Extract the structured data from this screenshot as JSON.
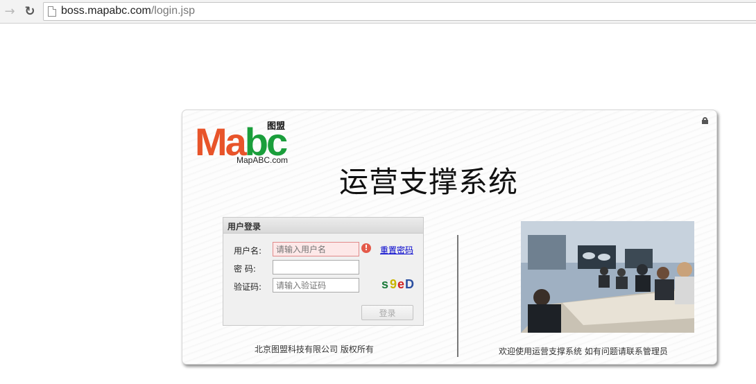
{
  "browser": {
    "url_domain": "boss.mapabc.com",
    "url_path": "/login.jsp",
    "forward_icon": "arrow-right-icon",
    "reload_icon": "reload-icon"
  },
  "logo": {
    "word_part1": "Ma",
    "word_part2": "bc",
    "cn_name": "图盟",
    "domain": "MapABC.com"
  },
  "page": {
    "title": "运营支撑系统",
    "copyright": "北京图盟科技有限公司 版权所有",
    "welcome": "欢迎使用运营支撑系统 如有问题请联系管理员"
  },
  "login": {
    "header": "用户登录",
    "username_label": "用户名:",
    "username_placeholder": "请输入用户名",
    "password_label": "密  码:",
    "captcha_label": "验证码:",
    "captcha_placeholder": "请输入验证码",
    "captcha_text": [
      "s",
      "9",
      "e",
      "D"
    ],
    "reset_link": "重置密码",
    "error_icon": "!",
    "submit": "登录"
  },
  "colors": {
    "logo_orange": "#e8542a",
    "logo_green": "#1a9e3b",
    "link_blue": "#0000cc",
    "error_red": "#e45a4a"
  }
}
